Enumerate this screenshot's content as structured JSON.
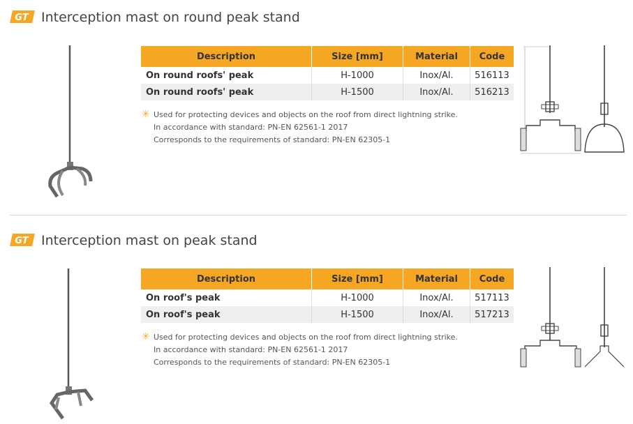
{
  "sections": [
    {
      "logo_text": "GT",
      "title": "Interception mast on round peak stand",
      "table": {
        "headers": [
          "Description",
          "Size [mm]",
          "Material",
          "Code"
        ],
        "rows": [
          [
            "On round roofs' peak",
            "H-1000",
            "Inox/Al.",
            "516113"
          ],
          [
            "On round roofs' peak",
            "H-1500",
            "Inox/Al.",
            "516213"
          ]
        ]
      },
      "notes": [
        "Used for protecting devices and objects on the roof from direct lightning strike.",
        "In accordance with standard: PN-EN 62561-1 2017",
        "Corresponds to the requirements of standard: PN-EN 62305-1"
      ]
    },
    {
      "logo_text": "GT",
      "title": "Interception mast on peak stand",
      "table": {
        "headers": [
          "Description",
          "Size [mm]",
          "Material",
          "Code"
        ],
        "rows": [
          [
            "On roof's peak",
            "H-1000",
            "Inox/Al.",
            "517113"
          ],
          [
            "On roof's peak",
            "H-1500",
            "Inox/Al.",
            "517213"
          ]
        ]
      },
      "notes": [
        "Used for protecting devices and objects on the roof from direct lightning strike.",
        "In accordance with standard: PN-EN 62561-1 2017",
        "Corresponds to the requirements of standard: PN-EN 62305-1"
      ]
    }
  ],
  "colors": {
    "accent": "#f5a623",
    "row_alt": "#efefef",
    "text": "#333333"
  }
}
